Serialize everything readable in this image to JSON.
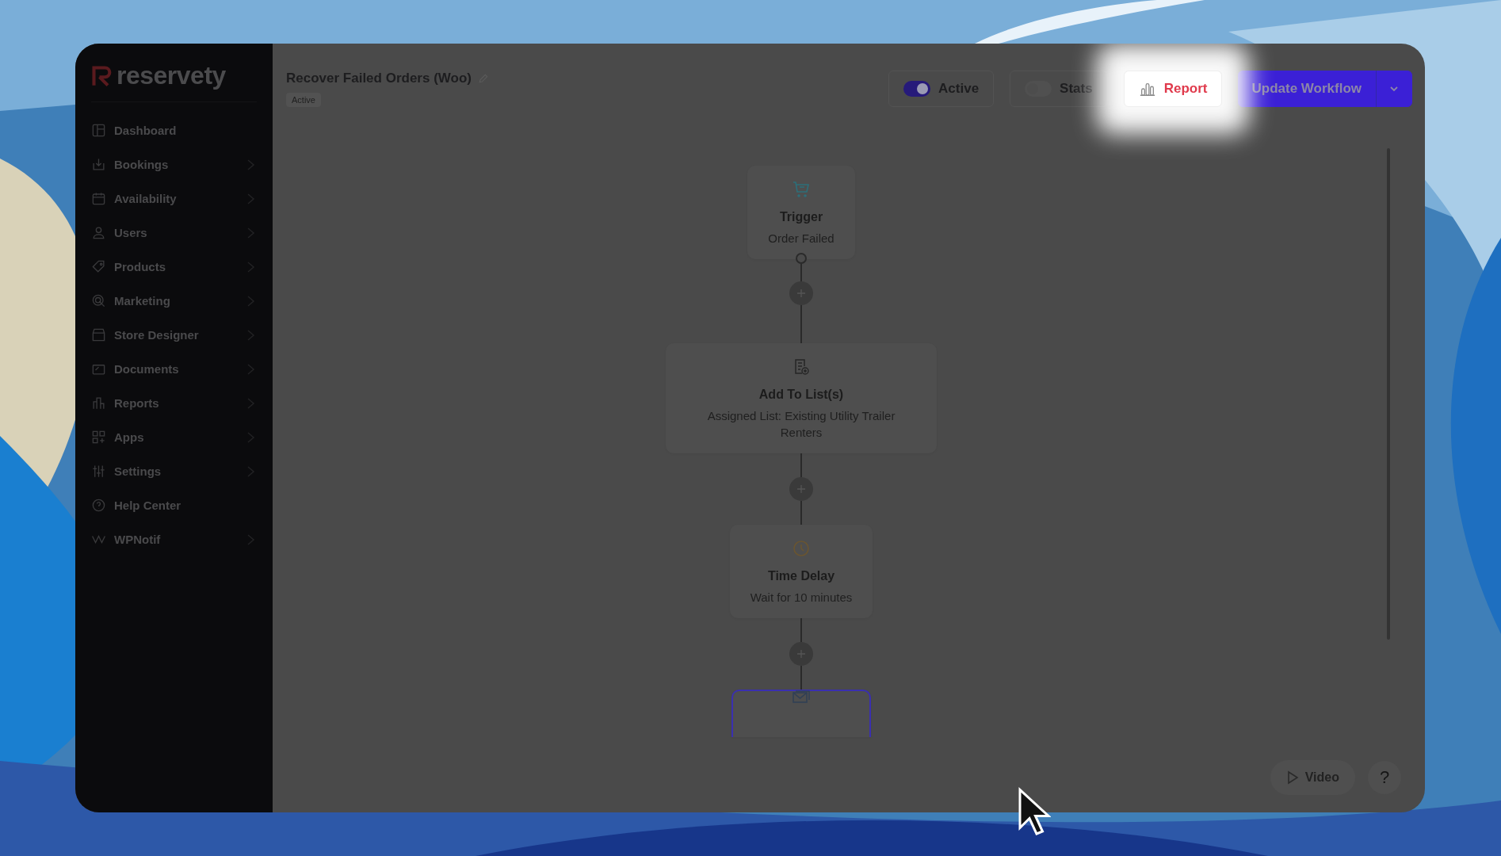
{
  "logo": {
    "text": "reservety"
  },
  "sidebar": {
    "items": [
      {
        "label": "Dashboard",
        "has_submenu": false
      },
      {
        "label": "Bookings",
        "has_submenu": true
      },
      {
        "label": "Availability",
        "has_submenu": true
      },
      {
        "label": "Users",
        "has_submenu": true
      },
      {
        "label": "Products",
        "has_submenu": true
      },
      {
        "label": "Marketing",
        "has_submenu": true
      },
      {
        "label": "Store Designer",
        "has_submenu": true
      },
      {
        "label": "Documents",
        "has_submenu": true
      },
      {
        "label": "Reports",
        "has_submenu": true
      },
      {
        "label": "Apps",
        "has_submenu": true
      },
      {
        "label": "Settings",
        "has_submenu": true
      },
      {
        "label": "Help Center",
        "has_submenu": false
      },
      {
        "label": "WPNotif",
        "has_submenu": true
      }
    ]
  },
  "header": {
    "title": "Recover Failed Orders (Woo)",
    "status": "Active",
    "active_toggle": {
      "label": "Active",
      "on": true
    },
    "stats_button": {
      "label": "Stats",
      "on": false
    },
    "report_button": {
      "label": "Report",
      "highlighted": true
    },
    "update_button": {
      "label": "Update Workflow"
    }
  },
  "flow": {
    "nodes": [
      {
        "kind": "trigger",
        "title": "Trigger",
        "description": "Order Failed",
        "selected": false
      },
      {
        "kind": "list",
        "title": "Add To List(s)",
        "description": "Assigned List: Existing Utility Trailer Renters",
        "selected": false
      },
      {
        "kind": "delay",
        "title": "Time Delay",
        "description": "Wait for 10 minutes",
        "selected": false
      },
      {
        "kind": "email",
        "selected": true
      }
    ]
  },
  "footer": {
    "video_button": "Video",
    "help_button": "?"
  }
}
